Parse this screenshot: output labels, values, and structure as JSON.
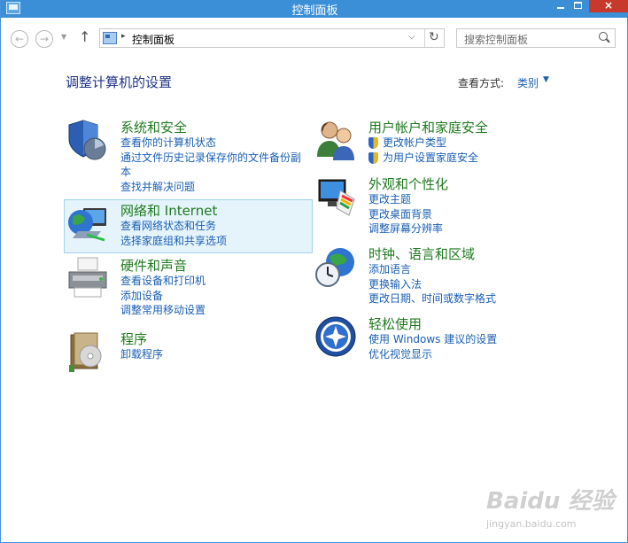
{
  "window": {
    "title": "控制面板",
    "controls": {
      "minimize": "",
      "maximize": "",
      "close": "×"
    }
  },
  "nav": {
    "back": "←",
    "forward": "→",
    "recent": "▼",
    "up": "↑",
    "separator": "▸",
    "breadcrumb": "控制面板",
    "dropdown": "⌵",
    "refresh": "↻"
  },
  "search": {
    "placeholder": "搜索控制面板"
  },
  "header": {
    "title": "调整计算机的设置",
    "view_by_label": "查看方式:",
    "view_by_value": "类别",
    "view_by_arrow": "▼"
  },
  "categories": [
    {
      "title": "系统和安全",
      "icon": "shield-icon",
      "links": [
        "查看你的计算机状态",
        "通过文件历史记录保存你的文件备份副",
        "本",
        "查找并解决问题"
      ]
    },
    {
      "title": "网络和 Internet",
      "icon": "network-icon",
      "links": [
        "查看网络状态和任务",
        "选择家庭组和共享选项"
      ]
    },
    {
      "title": "硬件和声音",
      "icon": "printer-icon",
      "links": [
        "查看设备和打印机",
        "添加设备",
        "调整常用移动设置"
      ]
    },
    {
      "title": "程序",
      "icon": "programs-icon",
      "links": [
        "卸载程序"
      ]
    },
    {
      "title": "用户帐户和家庭安全",
      "icon": "users-icon",
      "links": [
        "更改帐户类型",
        "为用户设置家庭安全"
      ]
    },
    {
      "title": "外观和个性化",
      "icon": "appearance-icon",
      "links": [
        "更改主题",
        "更改桌面背景",
        "调整屏幕分辨率"
      ]
    },
    {
      "title": "时钟、语言和区域",
      "icon": "clock-globe-icon",
      "links": [
        "添加语言",
        "更换输入法",
        "更改日期、时间或数字格式"
      ]
    },
    {
      "title": "轻松使用",
      "icon": "ease-of-access-icon",
      "links": [
        "使用 Windows 建议的设置",
        "优化视觉显示"
      ]
    }
  ],
  "watermark": {
    "brand": "Baidu 经验",
    "url": "jingyan.baidu.com"
  },
  "colors": {
    "title_bar": "#3b8fd6",
    "heading_blue": "#1e3287",
    "category_green": "#1f7a1f",
    "link_blue": "#1a5fb4",
    "hover_bg": "#e5f3fb",
    "close_red": "#c7392b"
  }
}
